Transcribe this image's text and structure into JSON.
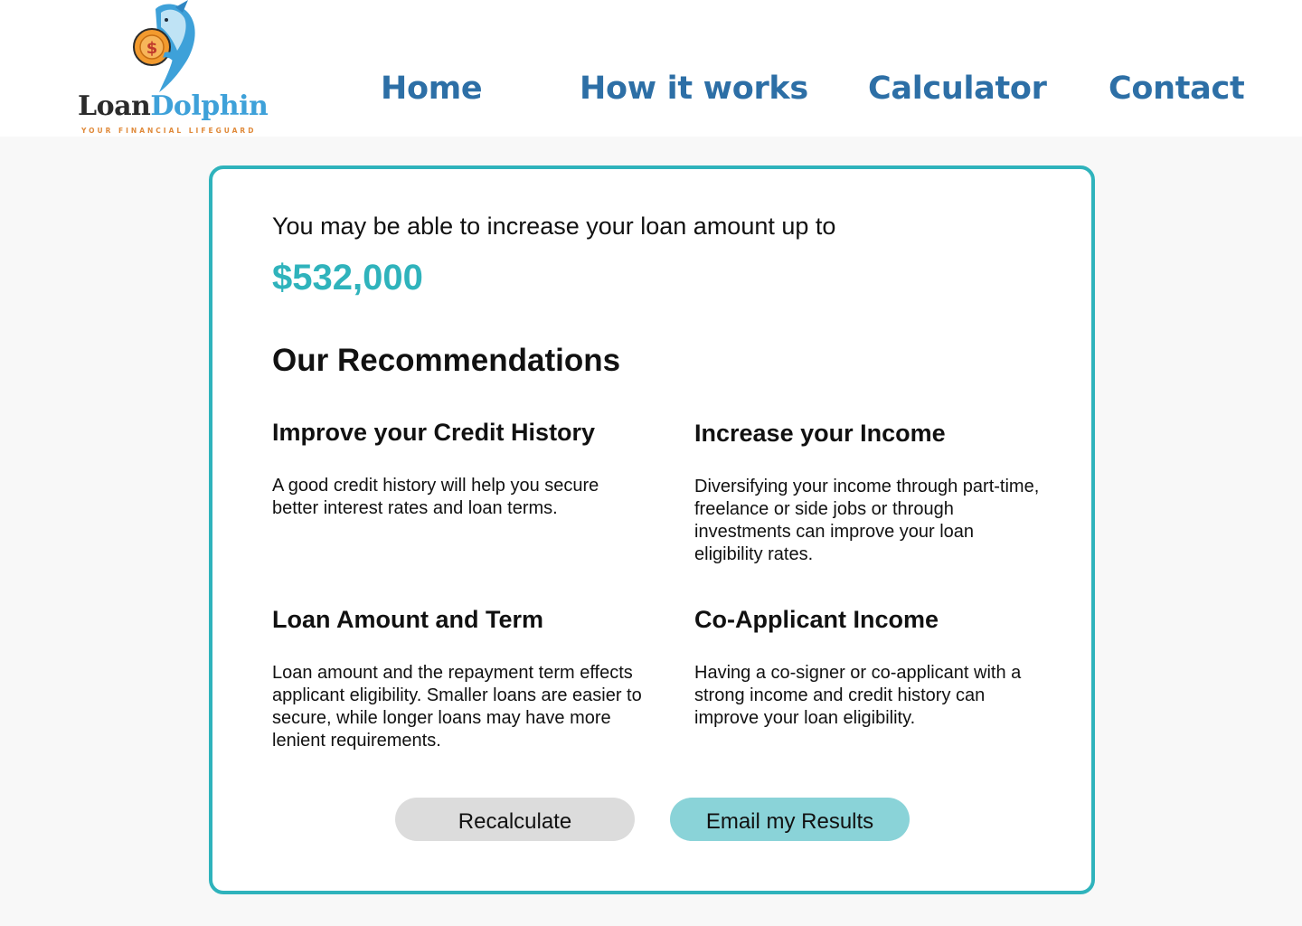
{
  "brand": {
    "name_part1": "Loan",
    "name_part2": "Dolphin",
    "tagline": "YOUR FINANCIAL LIFEGUARD",
    "colors": {
      "navy_text": "#2b2b2b",
      "dolphin_blue": "#3ea1d9",
      "tagline_orange": "#e08a3a",
      "coin_orange": "#f29a2e"
    }
  },
  "nav": {
    "items": [
      {
        "label": "Home"
      },
      {
        "label": "How it works"
      },
      {
        "label": "Calculator"
      },
      {
        "label": "Contact"
      }
    ],
    "color": "#2d6fa6"
  },
  "result": {
    "intro": "You may be able to increase your loan amount up to",
    "amount": "$532,000",
    "accent_color": "#2fb3bc"
  },
  "recommendations": {
    "title": "Our Recommendations",
    "items": [
      {
        "title": "Improve your Credit History",
        "body": "A good credit history will help you secure better interest rates and loan terms."
      },
      {
        "title": "Increase your Income",
        "body": "Diversifying your income through part-time, freelance or side jobs or through investments can improve your loan eligibility rates."
      },
      {
        "title": "Loan Amount and Term",
        "body": "Loan amount and the repayment term effects applicant eligibility. Smaller loans are easier to secure, while longer loans may have more lenient requirements."
      },
      {
        "title": "Co-Applicant Income",
        "body": "Having a co-signer or co-applicant with a strong income and credit history can improve your loan eligibility."
      }
    ]
  },
  "actions": {
    "recalculate_label": "Recalculate",
    "email_label": "Email my Results",
    "recalculate_color": "#dcdcdc",
    "email_color": "#8ad3d8"
  }
}
